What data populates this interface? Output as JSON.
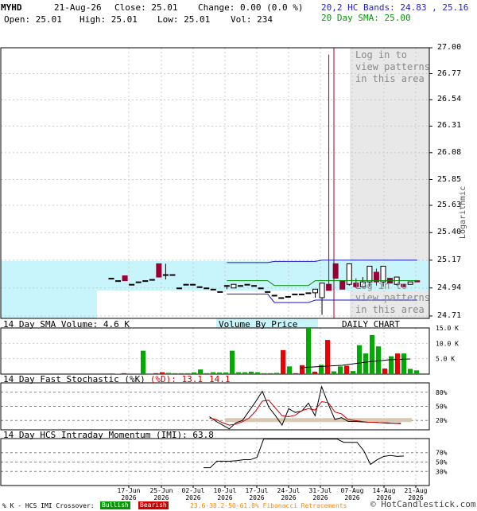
{
  "header": {
    "symbol": "MYHD",
    "date": "21-Aug-26",
    "close_label": "Close: 25.01",
    "change_label": "Change: 0.00 (0.0 %)",
    "open_label": "Open: 25.01",
    "high_label": "High: 25.01",
    "low_label": "Low: 25.01",
    "vol_label": "Vol: 234",
    "bands_label": "20,2 HC Bands: 24.83 , 25.16",
    "sma_label": "20 Day SMA: 25.00"
  },
  "panels": {
    "volume_title": "14 Day SMA Volume: 4.6 K",
    "volume_by_price": "Volume By Price",
    "daily_chart": "DAILY CHART",
    "stoch_title": "14 Day Fast Stochastic (%K)",
    "stoch_d": "(%D): 13.1",
    "stoch_k": "14.1",
    "momentum_title": "14 Day HCS Intraday Momentum (IMI): 63.8",
    "log_in_text": "Log in to view patterns in this area",
    "logarithmic": "Logarithmic"
  },
  "footer": {
    "crossover": "% K - HCS IMI Crossover:",
    "bullish": "Bullish",
    "bearish": "Bearish",
    "fib": "23.6-38.2-50-61.8% Fibonacci Retracements",
    "copyright": "© HotCandlestick.com"
  },
  "colors": {
    "band_fill": "#c8f4fc",
    "band_line": "#1818cc",
    "sma_line": "#008800",
    "bull": "#000000",
    "bear": "#990033",
    "vol_green": "#00aa00",
    "vol_red": "#ee0000",
    "grey_area": "#e8e8e8"
  },
  "chart_data": {
    "type": "candlestick",
    "y_ticks": [
      "27.00",
      "26.77",
      "26.54",
      "26.31",
      "26.08",
      "25.85",
      "25.63",
      "25.40",
      "25.17",
      "24.94",
      "24.71"
    ],
    "x_ticks": [
      {
        "label": "17-Jun",
        "year": "2026"
      },
      {
        "label": "25-Jun",
        "year": "2026"
      },
      {
        "label": "02-Jul",
        "year": "2026"
      },
      {
        "label": "10-Jul",
        "year": "2026"
      },
      {
        "label": "17-Jul",
        "year": "2026"
      },
      {
        "label": "24-Jul",
        "year": "2026"
      },
      {
        "label": "31-Jul",
        "year": "2026"
      },
      {
        "label": "07-Aug",
        "year": "2026"
      },
      {
        "label": "14-Aug",
        "year": "2026"
      },
      {
        "label": "21-Aug",
        "year": "2026"
      }
    ],
    "ylim": [
      24.71,
      27.0
    ],
    "candles": [
      {
        "o": 25.02,
        "h": 25.02,
        "l": 25.02,
        "c": 25.02
      },
      {
        "o": 25.0,
        "h": 25.0,
        "l": 25.0,
        "c": 25.0
      },
      {
        "o": 25.04,
        "h": 25.04,
        "l": 25.0,
        "c": 25.0
      },
      {
        "o": 24.97,
        "h": 24.97,
        "l": 24.97,
        "c": 24.97
      },
      {
        "o": 24.99,
        "h": 24.99,
        "l": 24.99,
        "c": 24.99
      },
      {
        "o": 25.0,
        "h": 25.0,
        "l": 25.0,
        "c": 25.0
      },
      {
        "o": 25.01,
        "h": 25.01,
        "l": 25.01,
        "c": 25.01
      },
      {
        "o": 25.14,
        "h": 25.14,
        "l": 25.03,
        "c": 25.03
      },
      {
        "o": 25.05,
        "h": 25.14,
        "l": 25.01,
        "c": 25.05
      },
      {
        "o": 25.05,
        "h": 25.05,
        "l": 25.05,
        "c": 25.05
      },
      {
        "o": 24.94,
        "h": 24.94,
        "l": 24.94,
        "c": 24.94
      },
      {
        "o": 24.97,
        "h": 24.97,
        "l": 24.97,
        "c": 24.97
      },
      {
        "o": 24.97,
        "h": 24.97,
        "l": 24.97,
        "c": 24.97
      },
      {
        "o": 24.95,
        "h": 24.95,
        "l": 24.95,
        "c": 24.95
      },
      {
        "o": 24.94,
        "h": 24.94,
        "l": 24.94,
        "c": 24.94
      },
      {
        "o": 24.93,
        "h": 24.93,
        "l": 24.93,
        "c": 24.93
      },
      {
        "o": 24.91,
        "h": 24.91,
        "l": 24.91,
        "c": 24.91
      },
      {
        "o": 24.96,
        "h": 24.96,
        "l": 24.93,
        "c": 24.96
      },
      {
        "o": 24.94,
        "h": 24.97,
        "l": 24.94,
        "c": 24.97
      },
      {
        "o": 24.96,
        "h": 24.96,
        "l": 24.96,
        "c": 24.96
      },
      {
        "o": 24.97,
        "h": 24.97,
        "l": 24.97,
        "c": 24.97
      },
      {
        "o": 24.96,
        "h": 24.96,
        "l": 24.96,
        "c": 24.96
      },
      {
        "o": 24.94,
        "h": 24.94,
        "l": 24.94,
        "c": 24.94
      },
      {
        "o": 24.91,
        "h": 24.91,
        "l": 24.91,
        "c": 24.91
      },
      {
        "o": 24.88,
        "h": 24.88,
        "l": 24.88,
        "c": 24.88
      },
      {
        "o": 24.86,
        "h": 24.86,
        "l": 24.86,
        "c": 24.86
      },
      {
        "o": 24.87,
        "h": 24.87,
        "l": 24.87,
        "c": 24.87
      },
      {
        "o": 24.89,
        "h": 24.89,
        "l": 24.89,
        "c": 24.89
      },
      {
        "o": 24.89,
        "h": 24.89,
        "l": 24.89,
        "c": 24.89
      },
      {
        "o": 24.9,
        "h": 24.9,
        "l": 24.9,
        "c": 24.9
      },
      {
        "o": 24.9,
        "h": 24.93,
        "l": 24.86,
        "c": 24.93
      },
      {
        "o": 24.86,
        "h": 24.98,
        "l": 24.72,
        "c": 24.98
      },
      {
        "o": 24.97,
        "h": 26.94,
        "l": 24.92,
        "c": 24.92
      },
      {
        "o": 25.14,
        "h": 25.14,
        "l": 25.02,
        "c": 25.02
      },
      {
        "o": 25.0,
        "h": 25.0,
        "l": 24.93,
        "c": 24.93
      },
      {
        "o": 24.97,
        "h": 25.14,
        "l": 24.96,
        "c": 25.14
      },
      {
        "o": 24.98,
        "h": 25.02,
        "l": 24.94,
        "c": 24.95
      },
      {
        "o": 24.95,
        "h": 25.03,
        "l": 24.94,
        "c": 24.99
      },
      {
        "o": 24.99,
        "h": 25.12,
        "l": 24.95,
        "c": 25.12
      },
      {
        "o": 25.07,
        "h": 25.1,
        "l": 24.96,
        "c": 24.99
      },
      {
        "o": 24.99,
        "h": 25.12,
        "l": 24.95,
        "c": 25.12
      },
      {
        "o": 25.02,
        "h": 25.02,
        "l": 24.98,
        "c": 24.98
      },
      {
        "o": 24.97,
        "h": 25.03,
        "l": 24.96,
        "c": 25.03
      },
      {
        "o": 24.97,
        "h": 24.97,
        "l": 24.95,
        "c": 24.95
      },
      {
        "o": 24.97,
        "h": 24.99,
        "l": 24.97,
        "c": 24.99
      },
      {
        "o": 25.0,
        "h": 25.0,
        "l": 24.99,
        "c": 24.99
      }
    ],
    "volume_ticks": [
      "15.0 K",
      "10.0 K",
      "5.0 K"
    ],
    "volume": [
      0.2,
      0.1,
      0.3,
      0.2,
      0.2,
      7.6,
      0.2,
      0.3,
      0.6,
      0.4,
      0.3,
      0.3,
      0.3,
      0.5,
      1.5,
      0.3,
      0.6,
      0.5,
      0.5,
      7.6,
      0.6,
      0.6,
      0.8,
      0.6,
      0.3,
      0.3,
      0.4,
      7.8,
      2.5,
      0.3,
      2.9,
      15.0,
      0.8,
      3.0,
      11.1,
      0.9,
      2.5,
      2.7,
      1.0,
      9.4,
      6.7,
      12.7,
      9.0,
      1.8,
      5.8,
      6.7,
      6.7,
      1.7,
      1.2
    ],
    "volume_colors": [
      "r",
      "g",
      "r",
      "g",
      "g",
      "g",
      "g",
      "r",
      "r",
      "g",
      "g",
      "g",
      "g",
      "g",
      "g",
      "g",
      "g",
      "g",
      "g",
      "g",
      "g",
      "g",
      "g",
      "g",
      "g",
      "g",
      "g",
      "r",
      "g",
      "r",
      "r",
      "g",
      "r",
      "g",
      "r",
      "g",
      "g",
      "r",
      "g",
      "g",
      "g",
      "g",
      "g",
      "r",
      "g",
      "r",
      "g",
      "g",
      "g"
    ],
    "stoch_ticks": [
      "80%",
      "50%",
      "20%"
    ],
    "stoch_k": [
      null,
      null,
      null,
      null,
      null,
      null,
      null,
      null,
      null,
      null,
      null,
      null,
      null,
      null,
      null,
      null,
      null,
      null,
      null,
      null,
      null,
      null,
      null,
      null,
      null,
      28,
      18,
      10,
      2,
      15,
      20,
      40,
      60,
      82,
      48,
      30,
      10,
      45,
      37,
      40,
      57,
      30,
      92,
      55,
      22,
      26,
      18,
      18,
      17,
      16,
      16,
      15,
      14,
      14,
      14
    ],
    "stoch_d": [
      null,
      null,
      null,
      null,
      null,
      null,
      null,
      null,
      null,
      null,
      null,
      null,
      null,
      null,
      null,
      null,
      null,
      null,
      null,
      null,
      null,
      null,
      null,
      null,
      null,
      25,
      22,
      15,
      10,
      12,
      17,
      25,
      40,
      61,
      63,
      46,
      30,
      28,
      31,
      41,
      45,
      42,
      60,
      58,
      38,
      34,
      22,
      20,
      18,
      16,
      16,
      15,
      15,
      14,
      13
    ],
    "imi_ticks": [
      "70%",
      "50%",
      "30%"
    ],
    "imi": [
      null,
      null,
      null,
      null,
      null,
      null,
      null,
      null,
      null,
      null,
      null,
      null,
      null,
      null,
      null,
      null,
      null,
      null,
      null,
      null,
      null,
      null,
      null,
      null,
      null,
      38,
      38,
      52,
      52,
      52,
      53,
      55,
      55,
      60,
      99,
      99,
      99,
      99,
      99,
      99,
      99,
      99,
      99,
      99,
      99,
      99,
      92,
      92,
      92,
      74,
      45,
      55,
      62,
      64,
      62,
      63
    ]
  }
}
